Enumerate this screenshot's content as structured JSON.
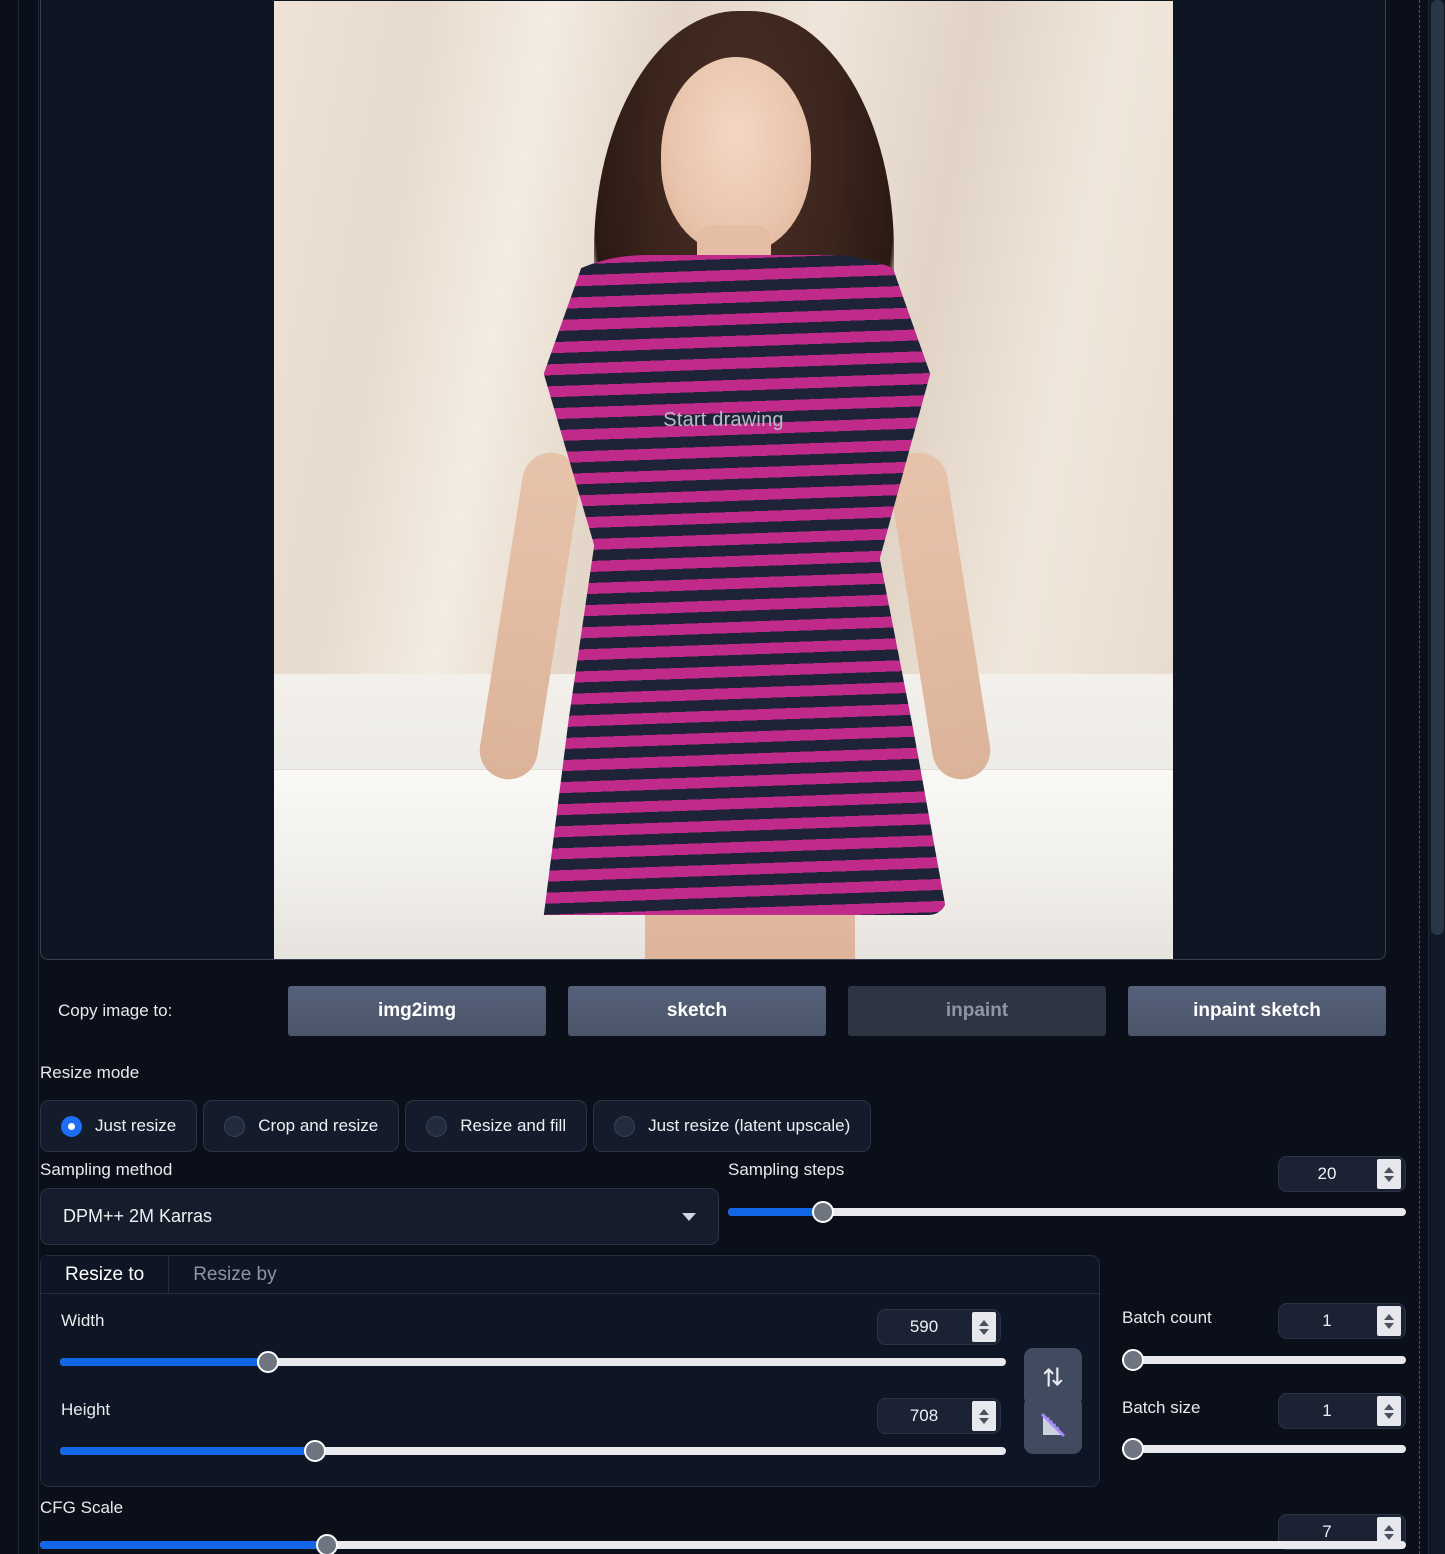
{
  "image_canvas": {
    "overlay_label": "Start drawing"
  },
  "copy_image": {
    "label": "Copy image to:",
    "buttons": [
      {
        "name": "img2img",
        "label": "img2img",
        "state": "enabled"
      },
      {
        "name": "sketch",
        "label": "sketch",
        "state": "enabled"
      },
      {
        "name": "inpaint",
        "label": "inpaint",
        "state": "disabled"
      },
      {
        "name": "inpaint sketch",
        "label": "inpaint sketch",
        "state": "enabled"
      }
    ]
  },
  "resize_mode": {
    "label": "Resize mode",
    "options": [
      {
        "label": "Just resize",
        "selected": true
      },
      {
        "label": "Crop and resize",
        "selected": false
      },
      {
        "label": "Resize and fill",
        "selected": false
      },
      {
        "label": "Just resize (latent upscale)",
        "selected": false
      }
    ]
  },
  "sampling": {
    "method_label": "Sampling method",
    "method_value": "DPM++ 2M Karras",
    "steps_label": "Sampling steps",
    "steps_value": "20",
    "steps_fill_pct": 14
  },
  "resize": {
    "tabs": [
      {
        "label": "Resize to",
        "active": true
      },
      {
        "label": "Resize by",
        "active": false
      }
    ],
    "width_label": "Width",
    "width_value": "590",
    "width_fill_pct": 22,
    "height_label": "Height",
    "height_value": "708",
    "height_fill_pct": 27,
    "swap_icon": "swap-vertical-arrows-icon",
    "ratio_icon": "set-ruler-triangle-icon"
  },
  "batch": {
    "count_label": "Batch count",
    "count_value": "1",
    "count_fill_pct": 0,
    "size_label": "Batch size",
    "size_value": "1",
    "size_fill_pct": 0
  },
  "cfg": {
    "label": "CFG Scale",
    "value": "7",
    "fill_pct": 21
  },
  "colors": {
    "background": "#0b0f19",
    "panel": "#0e1524",
    "accent_blue": "#1266e8",
    "radio_selected": "#1d6ef5",
    "button_face": "#4b5569",
    "text_primary": "#eef0f3",
    "text_muted": "#8e95a3",
    "slider_track": "#e9e9ee",
    "slider_knob": "#6e7480"
  }
}
